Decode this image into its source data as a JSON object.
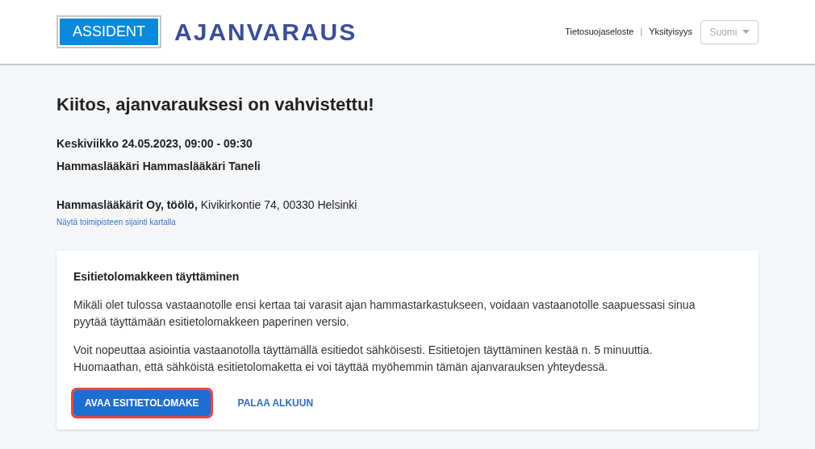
{
  "header": {
    "logo": "ASSIDENT",
    "title": "AJANVARAUS",
    "links": [
      "Tietosuojaseloste",
      "Yksityisyys"
    ],
    "separator": "|",
    "language": {
      "value": "Suomi",
      "disabled": true
    }
  },
  "confirmation": {
    "heading": "Kiitos, ajanvarauksesi on vahvistettu!",
    "datetime": "Keskiviikko 24.05.2023, 09:00 - 09:30",
    "provider": "Hammaslääkäri Hammaslääkäri Taneli",
    "address": "**Hammaslääkärit Oy, töölö,** Kivikirkontie 74, 00330 Helsinki",
    "map_link": "Näytä toimipisteen sijainti kartalla"
  },
  "card": {
    "title": "Esitietolomakkeen täyttäminen",
    "paragraphs": [
      "Mikäli olet tulossa vastaanotolle ensi kertaa tai varasit ajan hammastarkastukseen, voidaan vastaanotolle saapuessasi sinua pyytää täyttämään esitietolomakkeen paperinen versio.",
      "Voit nopeuttaa asiointia vastaanotolla täyttämällä esitiedot sähköisesti. Esitietojen täyttäminen kestää n. 5 minuuttia. Huomaathan, että sähköistä esitietolomaketta ei voi täyttää myöhemmin tämän ajanvarauksen yhteydessä."
    ],
    "buttons": [
      {
        "label": "AVAA ESITIETOLOMAKE",
        "kind": "primary",
        "highlighted": true
      },
      {
        "label": "PALAA ALKUUN",
        "kind": "text",
        "highlighted": false
      }
    ]
  }
}
